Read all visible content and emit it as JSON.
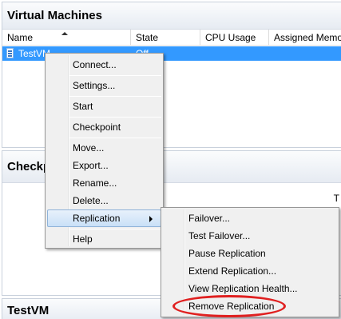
{
  "vm_panel": {
    "title": "Virtual Machines",
    "columns": [
      "Name",
      "State",
      "CPU Usage",
      "Assigned Memo"
    ],
    "selected_row": {
      "name": "TestVM",
      "state": "Off"
    }
  },
  "checkpoints_panel": {
    "title": "Checkpoints",
    "right_text": "T"
  },
  "testvm_panel": {
    "title": "TestVM"
  },
  "context_menu": {
    "items": [
      "Connect...",
      "Settings...",
      "Start",
      "Checkpoint",
      "Move...",
      "Export...",
      "Rename...",
      "Delete...",
      "Replication",
      "Help"
    ]
  },
  "replication_submenu": {
    "items": [
      "Failover...",
      "Test Failover...",
      "Pause Replication",
      "Extend Replication...",
      "View Replication Health...",
      "Remove Replication"
    ]
  },
  "colors": {
    "selection": "#3399ff",
    "highlight_ellipse": "#e02020",
    "menu_background": "#f0f0f0"
  },
  "icons": [
    "sort-ascending-icon",
    "vm-icon",
    "submenu-arrow-icon"
  ]
}
